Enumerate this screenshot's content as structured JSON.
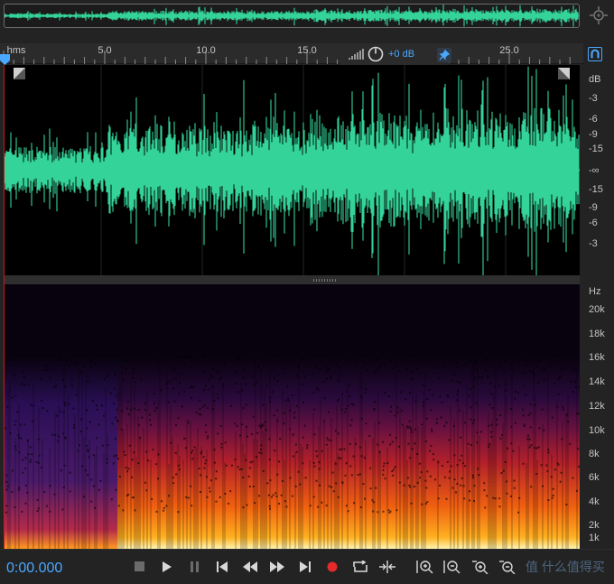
{
  "ruler": {
    "ticks": [
      {
        "label": "hms",
        "t": 0
      },
      {
        "label": "5.0",
        "t": 5
      },
      {
        "label": "10.0",
        "t": 10
      },
      {
        "label": "15.0",
        "t": 15
      },
      {
        "label": "25.0",
        "t": 25
      }
    ]
  },
  "hud": {
    "volume": "+0 dB"
  },
  "waveform": {
    "unit": "dB",
    "scale_labels": [
      "dB",
      "-3",
      "-6",
      "-9",
      "-15",
      "-∞",
      "-15",
      "-9",
      "-6",
      "-3"
    ],
    "color": "#34d399"
  },
  "spectral": {
    "unit": "Hz",
    "scale_labels": [
      "Hz",
      "20k",
      "18k",
      "16k",
      "14k",
      "12k",
      "10k",
      "8k",
      "6k",
      "4k",
      "2k",
      "1k"
    ]
  },
  "transport": {
    "timecode": "0:00.000",
    "buttons": [
      "stop",
      "play",
      "pause",
      "go-to-start",
      "rewind",
      "fast-forward",
      "go-to-end",
      "record",
      "loop",
      "skip-selection",
      "zoom-in-amplitude",
      "zoom-out-amplitude",
      "zoom-in-time",
      "zoom-out-time"
    ],
    "watermark": "值 什么值得买"
  },
  "colors": {
    "accent": "#4aa8ff",
    "record": "#e32b2b",
    "wave": "#34d399"
  },
  "icons": [
    "zoom-navigator-icon",
    "level-meter-icon",
    "volume-knob-icon",
    "pin-icon",
    "magnet-icon",
    "fade-in-handle",
    "fade-out-handle"
  ]
}
